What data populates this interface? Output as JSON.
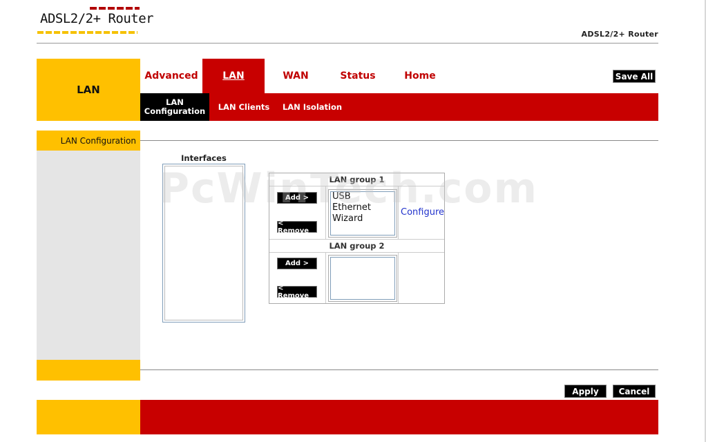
{
  "header": {
    "logo_text": "ADSL2/2+ Router",
    "product_name": "ADSL2/2+ Router"
  },
  "nav": {
    "section_title": "LAN",
    "tabs": [
      {
        "label": "Advanced"
      },
      {
        "label": "LAN"
      },
      {
        "label": "WAN"
      },
      {
        "label": "Status"
      },
      {
        "label": "Home"
      }
    ],
    "save_all_label": "Save All",
    "subtabs": [
      {
        "label": "LAN Configuration"
      },
      {
        "label": "LAN Clients"
      },
      {
        "label": "LAN Isolation"
      }
    ]
  },
  "sidebar": {
    "page_label": "LAN Configuration"
  },
  "interfaces": {
    "title": "Interfaces"
  },
  "groups": [
    {
      "title": "LAN group 1",
      "add_label": "Add >",
      "remove_label": "< Remove",
      "members": [
        "USB",
        "Ethernet",
        "Wizard"
      ],
      "configure_label": "Configure"
    },
    {
      "title": "LAN group 2",
      "add_label": "Add >",
      "remove_label": "< Remove"
    }
  ],
  "watermark": "PcWinTech.com",
  "actions": {
    "apply_label": "Apply",
    "cancel_label": "Cancel"
  },
  "colors": {
    "brand_red": "#c80000",
    "brand_yellow": "#ffc000",
    "sidebar_grey": "#e5e5e5",
    "link_blue": "#2233cc"
  }
}
